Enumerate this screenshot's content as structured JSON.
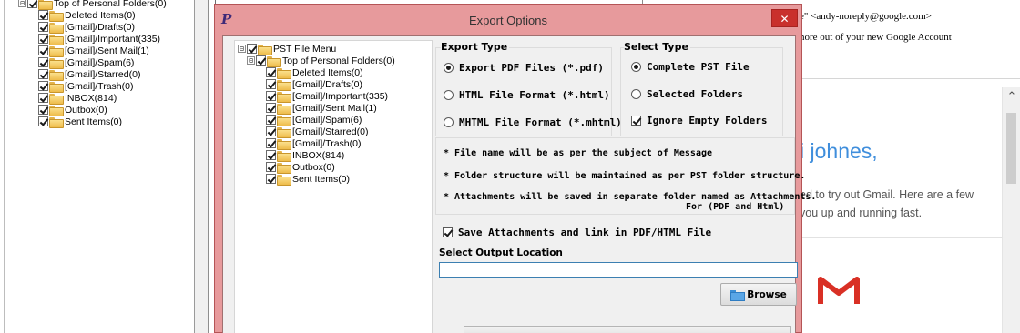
{
  "background": {
    "left_tree": {
      "items": [
        {
          "label": "Top of Personal Folders(0)",
          "expander": "⊟"
        },
        {
          "label": "Deleted Items(0)"
        },
        {
          "label": "[Gmail]/Drafts(0)"
        },
        {
          "label": "[Gmail]/Important(335)"
        },
        {
          "label": "[Gmail]/Sent Mail(1)"
        },
        {
          "label": "[Gmail]/Spam(6)"
        },
        {
          "label": "[Gmail]/Starred(0)"
        },
        {
          "label": "[Gmail]/Trash(0)"
        },
        {
          "label": "INBOX(814)"
        },
        {
          "label": "Outbox(0)"
        },
        {
          "label": "Sent Items(0)"
        }
      ]
    },
    "email": {
      "from_line": "e\" <andy-noreply@google.com>",
      "subject_line": "nore out of your new Google Account",
      "greeting": "i johnes,",
      "body_line_1": "ed to try out Gmail. Here are a few",
      "body_line_2": "you up and running fast."
    }
  },
  "dialog": {
    "title": "Export Options",
    "close_glyph": "✕",
    "app_icon_glyph": "P",
    "tree": {
      "root_label": "PST File Menu",
      "items": [
        {
          "label": "Top of Personal Folders(0)"
        },
        {
          "label": "Deleted Items(0)"
        },
        {
          "label": "[Gmail]/Drafts(0)"
        },
        {
          "label": "[Gmail]/Important(335)"
        },
        {
          "label": "[Gmail]/Sent Mail(1)"
        },
        {
          "label": "[Gmail]/Spam(6)"
        },
        {
          "label": "[Gmail]/Starred(0)"
        },
        {
          "label": "[Gmail]/Trash(0)"
        },
        {
          "label": "INBOX(814)"
        },
        {
          "label": "Outbox(0)"
        },
        {
          "label": "Sent Items(0)"
        }
      ]
    },
    "export_type": {
      "title": "Export Type",
      "options": [
        {
          "label": "Export PDF Files (*.pdf)",
          "selected": true
        },
        {
          "label": "HTML File  Format (*.html)",
          "selected": false
        },
        {
          "label": "MHTML File  Format (*.mhtml)",
          "selected": false
        }
      ]
    },
    "select_type": {
      "title": "Select Type",
      "options": [
        {
          "label": "Complete PST File",
          "selected": true
        },
        {
          "label": "Selected Folders",
          "selected": false
        }
      ],
      "ignore_empty_label": "Ignore Empty Folders",
      "ignore_empty_checked": true
    },
    "info": {
      "line_1": "* File name will be as per the subject of Message",
      "line_2": "* Folder structure will be maintained as per PST folder structure.",
      "line_3": "* Attachments will be saved in separate folder named as Attachments.",
      "line_4": "For (PDF and Html)"
    },
    "save_attachments": {
      "label": "Save Attachments and link in PDF/HTML File",
      "checked": true
    },
    "output": {
      "label": "Select Output Location",
      "value": ""
    },
    "browse_label": "Browse"
  },
  "colors": {
    "dialog_frame": "#e79a9c",
    "close_button": "#c9302c",
    "greeting_blue": "#3f8edc",
    "gmail_red": "#d93025"
  }
}
